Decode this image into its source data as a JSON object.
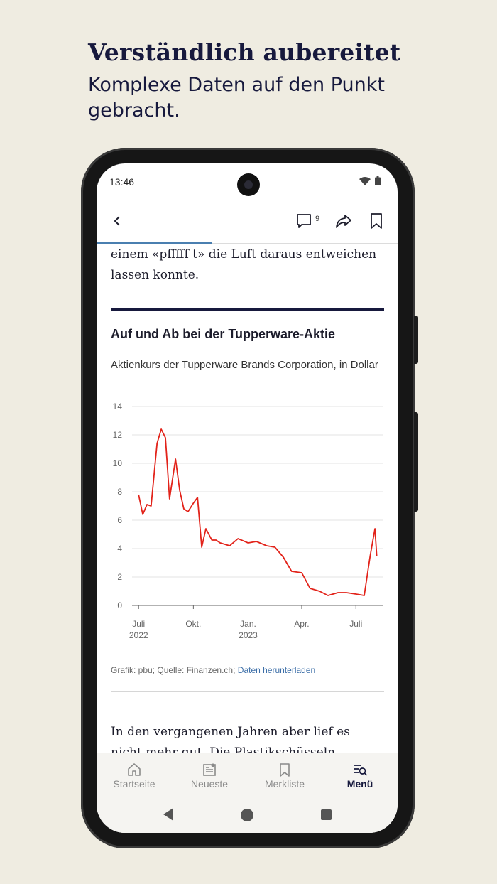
{
  "promo": {
    "title": "Verständlich aubereitet",
    "subtitle": "Komplexe Daten auf den Punkt gebracht."
  },
  "status": {
    "time": "13:46"
  },
  "toolbar": {
    "comment_count": "9"
  },
  "article": {
    "lead_text": "einem «pfffff t» die Luft daraus entweichen lassen konnte.",
    "next_paragraph": "In den vergangenen Jahren aber lief es nicht mehr gut. Die Plastikschüsseln bekamen ein"
  },
  "graphic": {
    "title": "Auf und Ab bei der Tupperware-Aktie",
    "subtitle": "Aktienkurs der Tupperware Brands Corporation, in Dollar",
    "credit": "Grafik: pbu; Quelle: Finanzen.ch;",
    "download_link": "Daten herunterladen"
  },
  "chart_data": {
    "type": "line",
    "series": [
      {
        "x": [
          "2022-07-01",
          "2022-07-08",
          "2022-07-15",
          "2022-07-22",
          "2022-08-01",
          "2022-08-08",
          "2022-08-15",
          "2022-08-22",
          "2022-09-01",
          "2022-09-08",
          "2022-09-15",
          "2022-09-22",
          "2022-10-01",
          "2022-10-08",
          "2022-10-15",
          "2022-10-22",
          "2022-11-01",
          "2022-11-08",
          "2022-11-15",
          "2022-12-01",
          "2022-12-15",
          "2023-01-01",
          "2023-01-15",
          "2023-02-01",
          "2023-02-15",
          "2023-03-01",
          "2023-03-15",
          "2023-04-01",
          "2023-04-15",
          "2023-05-01",
          "2023-05-15",
          "2023-06-01",
          "2023-06-15",
          "2023-07-01",
          "2023-07-15",
          "2023-07-25",
          "2023-08-02",
          "2023-08-05"
        ],
        "values": [
          7.8,
          6.4,
          7.1,
          7.0,
          11.4,
          12.4,
          11.8,
          7.5,
          10.3,
          8.1,
          6.8,
          6.6,
          7.2,
          7.6,
          4.1,
          5.4,
          4.6,
          4.6,
          4.4,
          4.2,
          4.7,
          4.4,
          4.5,
          4.2,
          4.1,
          3.4,
          2.4,
          2.3,
          1.2,
          1.0,
          0.7,
          0.9,
          0.9,
          0.8,
          0.7,
          3.5,
          5.4,
          3.5
        ],
        "color": "#e2231a"
      }
    ],
    "xticks": [
      {
        "line1": "Juli",
        "line2": "2022",
        "date": "2022-07-01"
      },
      {
        "line1": "Okt.",
        "line2": "",
        "date": "2022-10-01"
      },
      {
        "line1": "Jan.",
        "line2": "2023",
        "date": "2023-01-01"
      },
      {
        "line1": "Apr.",
        "line2": "",
        "date": "2023-04-01"
      },
      {
        "line1": "Juli",
        "line2": "",
        "date": "2023-07-01"
      }
    ],
    "yticks": [
      0,
      2,
      4,
      6,
      8,
      10,
      12,
      14
    ],
    "ylim": [
      0,
      14
    ],
    "grid": true
  },
  "nav": {
    "items": [
      {
        "label": "Startseite",
        "icon": "home-icon"
      },
      {
        "label": "Neueste",
        "icon": "news-icon"
      },
      {
        "label": "Merkliste",
        "icon": "bookmark-icon"
      },
      {
        "label": "Menü",
        "icon": "menu-search-icon"
      }
    ]
  }
}
